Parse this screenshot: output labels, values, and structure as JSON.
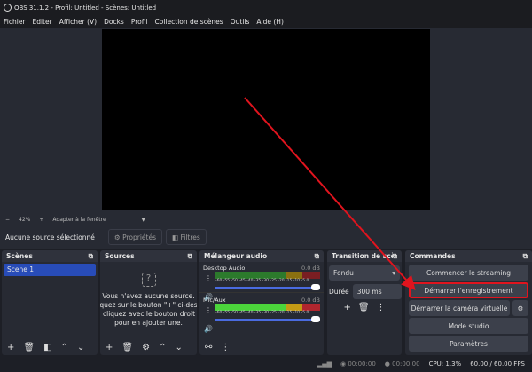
{
  "window": {
    "title": "OBS 31.1.2 - Profil: Untitled - Scènes: Untitled"
  },
  "menu": [
    "Fichier",
    "Editer",
    "Afficher (V)",
    "Docks",
    "Profil",
    "Collection de scènes",
    "Outils",
    "Aide (H)"
  ],
  "zoom": {
    "minus": "−",
    "value": "42%",
    "plus": "+",
    "mode": "Adapter à la fenêtre"
  },
  "source_bar": {
    "status": "Aucune source sélectionné",
    "properties": "Propriétés",
    "filters": "Filtres"
  },
  "scenes": {
    "title": "Scènes",
    "items": [
      "Scene 1"
    ]
  },
  "sources": {
    "title": "Sources",
    "empty_lines": [
      "Vous n'avez aucune source.",
      "Cliquez sur le bouton \"+\" ci-dessous,",
      "ou cliquez avec le bouton droit ici",
      "pour en ajouter une."
    ]
  },
  "mixer": {
    "title": "Mélangeur audio",
    "ticks": "-60 -55 -50 -45 -40 -35 -30 -25 -20 -15 -10 -5 0",
    "channels": [
      {
        "name": "Desktop Audio",
        "level": "0.0 dB",
        "volume": 1.0
      },
      {
        "name": "Mic/Aux",
        "level": "0.0 dB",
        "volume": 1.0
      }
    ]
  },
  "transition": {
    "title": "Transition de scè...",
    "type": "Fondu",
    "duration_label": "Durée",
    "duration": "300 ms"
  },
  "controls": {
    "title": "Commandes",
    "buttons": [
      "Commencer le streaming",
      "Démarrer l'enregistrement",
      "Démarrer la caméra virtuelle",
      "Mode studio",
      "Paramètres"
    ]
  },
  "status": {
    "stream_time": "00:00:00",
    "rec_time": "00:00:00",
    "cpu": "CPU: 1.3%",
    "fps": "60.00 / 60.00 FPS"
  },
  "colors": {
    "highlight": "#e0141e",
    "accent": "#284cb8"
  }
}
